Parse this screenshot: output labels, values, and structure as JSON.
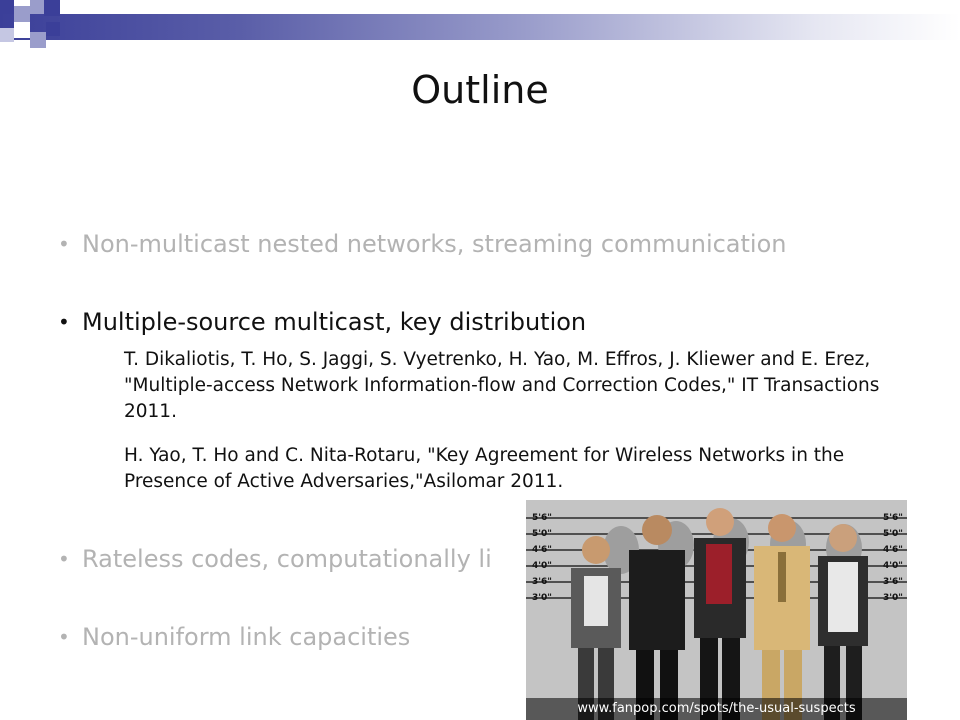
{
  "slide": {
    "title": "Outline",
    "bullets": [
      {
        "text": "Non-multicast nested networks, streaming communication",
        "state": "dimmed"
      },
      {
        "text": "Multiple-source multicast, key distribution",
        "state": "active"
      },
      {
        "text": "Rateless codes, computationally limited networks",
        "state": "dimmed",
        "visible_text": "Rateless codes, computationally li"
      },
      {
        "text": "Non-uniform link capacities",
        "state": "dimmed"
      }
    ],
    "references": [
      "T. Dikaliotis, T. Ho, S. Jaggi, S. Vyetrenko, H. Yao, M. Effros, J. Kliewer and E. Erez, \"Multiple-access Network Information-flow and Correction Codes,\" IT Transactions 2011.",
      "H. Yao, T. Ho and C. Nita-Rotaru, \"Key Agreement for Wireless Networks in the Presence of Active Adversaries,\"Asilomar 2011."
    ],
    "image": {
      "credit": "www.fanpop.com/spots/the-usual-suspects",
      "height_marks_left": [
        "5'6\"",
        "5'0\"",
        "4'6\"",
        "4'0\"",
        "3'6\"",
        "3'0\""
      ],
      "height_marks_right": [
        "5'6\"",
        "5'0\"",
        "4'6\"",
        "4'0\"",
        "3'6\"",
        "3'0\""
      ]
    }
  },
  "colors": {
    "dimmed_text": "#b3b3b3",
    "active_text": "#111111",
    "accent_dark": "#3b3f99",
    "accent_light": "#9a9dcb"
  }
}
